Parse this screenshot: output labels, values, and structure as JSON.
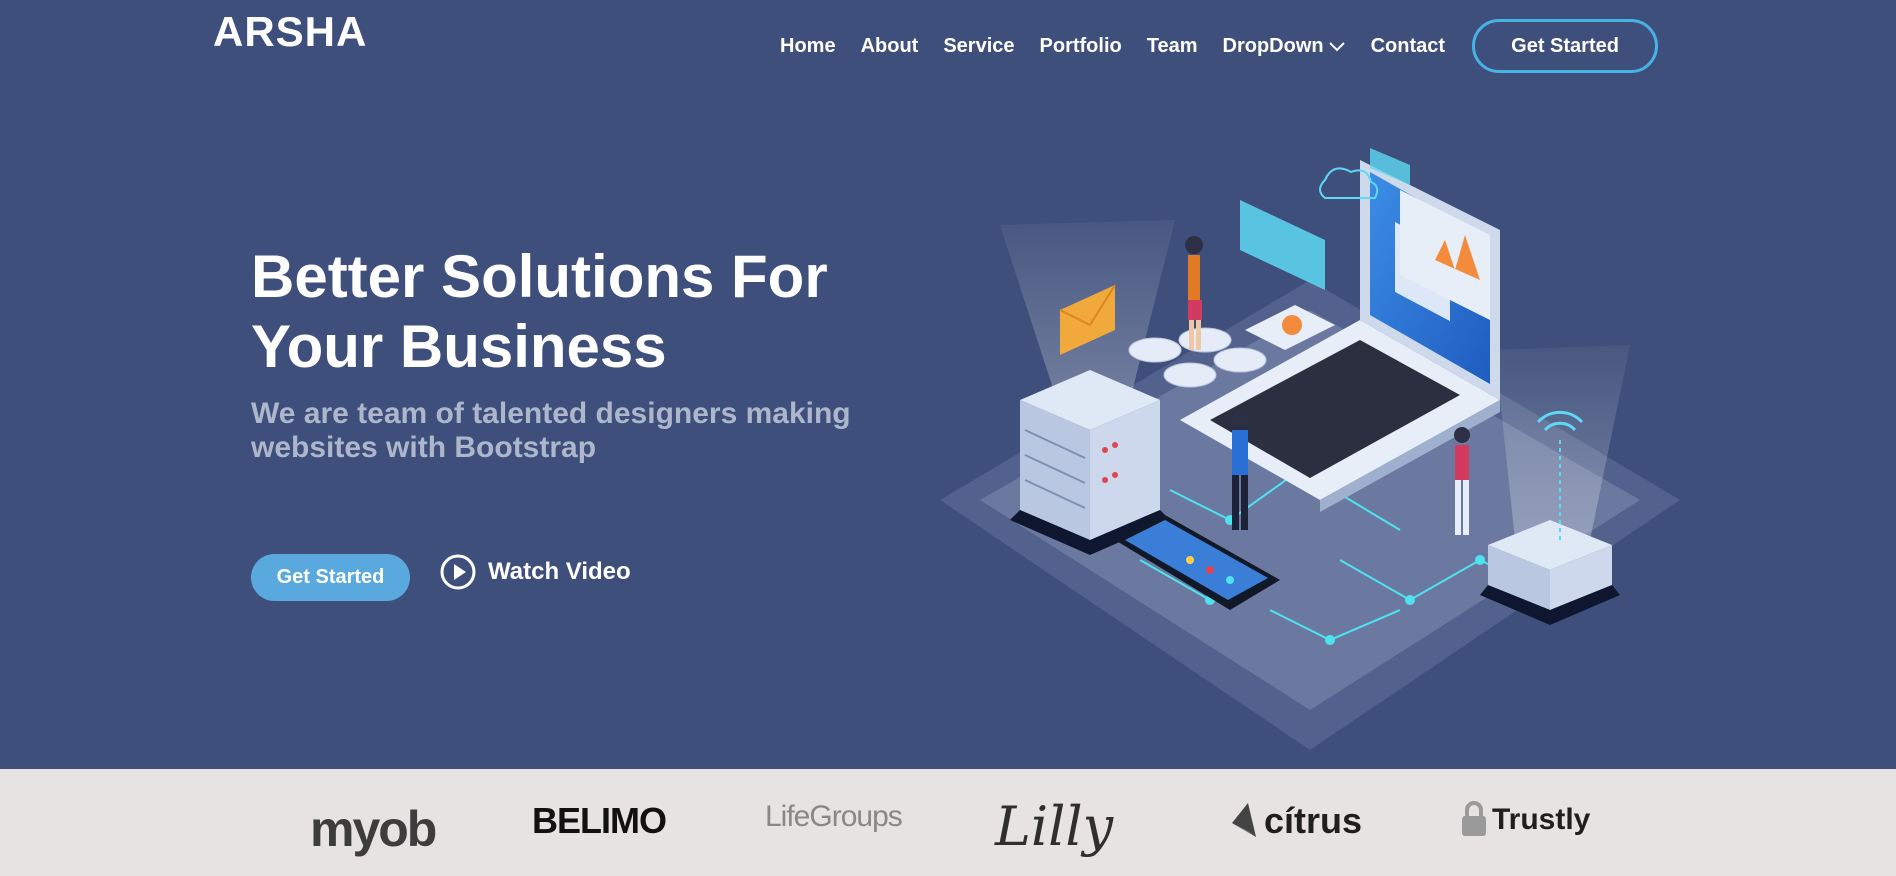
{
  "brand": {
    "logo": "ARSHA"
  },
  "nav": {
    "items": [
      "Home",
      "About",
      "Service",
      "Portfolio",
      "Team",
      "DropDown",
      "Contact"
    ],
    "cta": "Get Started"
  },
  "hero": {
    "title_line1": "Better Solutions For",
    "title_line2": "Your Business",
    "subtitle_line1": "We are team of talented designers making",
    "subtitle_line2": "websites with Bootstrap",
    "primary_button": "Get Started",
    "video_link": "Watch Video"
  },
  "clients": {
    "logos": [
      "myob",
      "BELIMO",
      "LifeGroups",
      "Lilly",
      "cítrus",
      "Trustly"
    ]
  },
  "colors": {
    "hero_bg": "#3e4f7b",
    "accent": "#47b2e4",
    "button": "#5aa9de",
    "clients_bg": "#e6e3e2"
  },
  "icons": [
    "chevron-down-icon",
    "play-circle-icon"
  ]
}
